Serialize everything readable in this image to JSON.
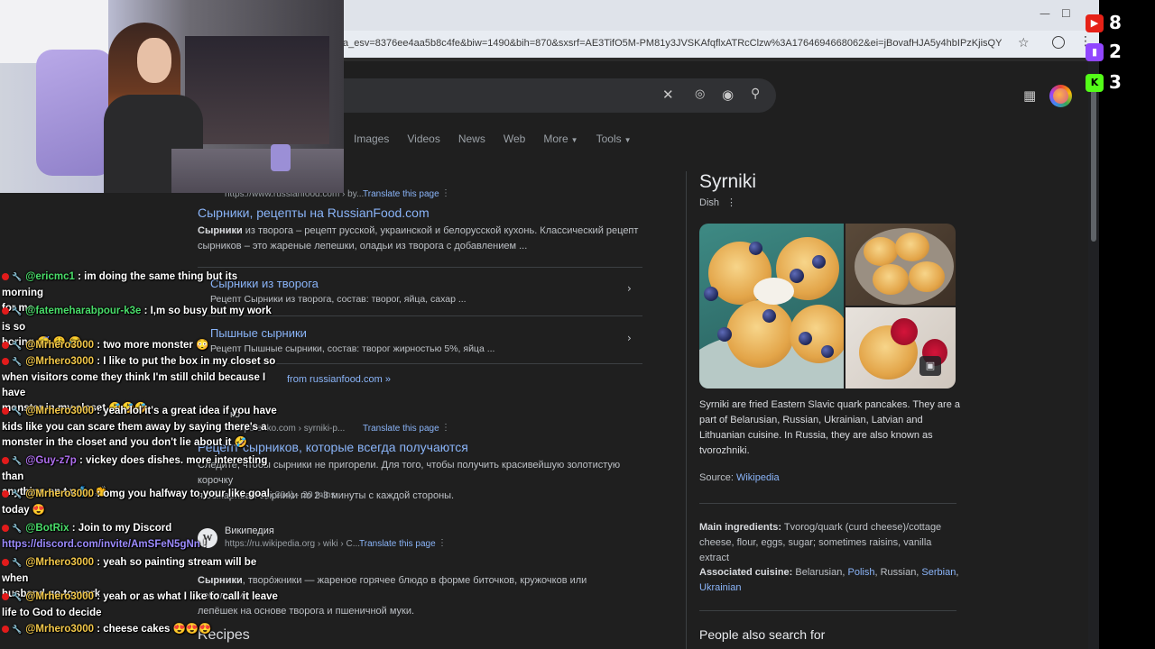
{
  "browser": {
    "url": "a_esv=8376ee4aa5b8c4fe&biw=1490&bih=870&sxsrf=AE3TifO5M-PM81y3JVSKAfqflxATRcClzw%3A1764694668062&ei=jBovafHJA5y4hbIPzKjisQY...",
    "win_minimize": "—",
    "win_maximize": "☐",
    "win_close": "✕",
    "star_glyph": "☆",
    "menu_glyph": "⋮"
  },
  "search": {
    "clear_glyph": "✕",
    "mic_glyph": "🎤",
    "lens_glyph": "◉",
    "search_glyph": "🔍",
    "apps_glyph": "⋮⋮⋮"
  },
  "tabs": [
    {
      "label": "Images"
    },
    {
      "label": "Videos"
    },
    {
      "label": "News"
    },
    {
      "label": "Web"
    },
    {
      "label": "More",
      "caret": "▼"
    },
    {
      "label": "Tools",
      "caret": "▼"
    }
  ],
  "results": {
    "r1": {
      "url": "https://www.russianfood.com › by...",
      "translate": "Translate this page",
      "dots": "⋮",
      "title": "Сырники, рецепты на RussianFood.com",
      "snippet_bold": "Сырники",
      "snippet_1": " из творога – рецепт русской, украинской и белорусской кухонь. Классический рецепт",
      "snippet_2": "сырников – это жареные лепешки, оладьи из творога с добавлением ...",
      "sub1_title": "Сырники из творога",
      "sub1_text": "Рецепт Сырники из творога, состав: творог, яйца, сахар ...",
      "sub2_title": "Пышные сырники",
      "sub2_text": "Рецепт Пышные сырники, состав: творог жирностью 5%, яйца ...",
      "chevron": "›",
      "more": "from russianfood.com »"
    },
    "r2": {
      "site": "ко",
      "url": "/klopotenko.com › syrniki-p...",
      "translate": "Translate this page",
      "dots": "⋮",
      "title": "Рецепт сырников, которые всегда получаются",
      "snippet_1": "Следите, чтобы сырники не пригорели. Для того, чтобы получить красивейшую золотистую корочку",
      "snippet_2": "я обжаривал сырники по 2-3 минуты с каждой стороны.",
      "rating": "★ (5,204) · 20 mins"
    },
    "r3": {
      "icon": "W",
      "site": "Википедия",
      "url": "https://ru.wikipedia.org › wiki › С...",
      "translate": "Translate this page",
      "dots": "⋮",
      "snippet_bold": "Сырники",
      "snippet_1": ", творо́жники — жареное горячее блюдо в форме биточков, кружочков или небольших",
      "snippet_2": "лепёшек на основе творога и пшеничной муки."
    },
    "recipes_heading": "Recipes"
  },
  "knowledge_panel": {
    "title": "Syrniki",
    "subtitle": "Dish",
    "dots": "⋮",
    "img_icon": "▣",
    "description": "Syrniki are fried Eastern Slavic quark pancakes. They are a part of Belarusian, Russian, Ukrainian, Latvian and Lithuanian cuisine. In Russia, they are also known as tvorozhniki.",
    "source_label": "Source: ",
    "source_link": "Wikipedia",
    "main_ingredients_label": "Main ingredients:",
    "main_ingredients": " Tvorog/quark (curd cheese)/cottage cheese, flour, eggs, sugar; sometimes raisins, vanilla extract",
    "cuisine_label": "Associated cuisine:",
    "cuisine_1": " Belarusian, ",
    "cuisine_2": "Polish",
    "cuisine_3": ", Russian, ",
    "cuisine_4": "Serbian",
    "cuisine_5": ",",
    "cuisine_6": "Ukrainian",
    "people_also": "People also search for"
  },
  "counters": [
    {
      "platform": "youtube",
      "icon": "▶",
      "color": "#e62117",
      "count": "8"
    },
    {
      "platform": "twitch",
      "icon": "▮",
      "color": "#9146ff",
      "count": "2"
    },
    {
      "platform": "kick",
      "icon": "K",
      "color": "#53fc18",
      "count": "3"
    }
  ],
  "chat": [
    {
      "user": "@ericmc1",
      "color": "green",
      "text": " : im doing the same thing but its morning",
      "cont": "for me"
    },
    {
      "user": "@fatemeharabpour-k3e",
      "color": "green",
      "text": " : I,m so busy but my work is so",
      "cont": "boring 😴 😩 😂"
    },
    {
      "user": "@Mrhero3000",
      "color": "yellow",
      "text": " : two more monster 😳",
      "cont": ""
    },
    {
      "user": "@Mrhero3000",
      "color": "yellow",
      "text": " : I like to put the box in my closet so",
      "cont": "when visitors come they think I'm still child because I have",
      "cont2": "monster in my closet 🤣🤣🤣"
    },
    {
      "user": "@Mrhero3000",
      "color": "yellow",
      "text": " : yeah lol it's a great idea if you have",
      "cont": "kids like you can scare them away by saying there's a",
      "cont2": "monster in the closet and you don't lie about it 🤣"
    },
    {
      "user": "@Guy-z7p",
      "color": "pink",
      "text": " : vickey does dishes. more interesting than",
      "cont": "anything on t.v 🧞 👏"
    },
    {
      "user": "@Mrhero3000",
      "color": "yellow",
      "text": " : omg you halfway to your like goal",
      "cont": "today 😍"
    },
    {
      "user": "@BotRix",
      "color": "green",
      "text": " : Join to my Discord",
      "link": "https://discord.com/invite/AmSFeN5gNn",
      "link_tail": " !"
    },
    {
      "user": "@Mrhero3000",
      "color": "yellow",
      "text": " : yeah so painting stream will be when",
      "cont": "husband go to work"
    },
    {
      "user": "@Mrhero3000",
      "color": "yellow",
      "text": " : yeah or as what I like to call it leave",
      "cont": "life to God to decide"
    },
    {
      "user": "@Mrhero3000",
      "color": "yellow",
      "text": " : cheese cakes 😍😍😍",
      "cont": ""
    }
  ]
}
